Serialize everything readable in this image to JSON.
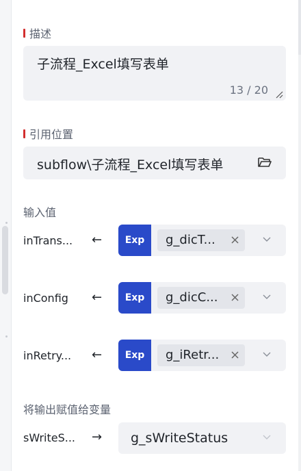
{
  "description": {
    "label": "描述",
    "value": "子流程_Excel填写表单",
    "counter": "13 / 20"
  },
  "reference": {
    "label": "引用位置",
    "value": "subflow\\子流程_Excel填写表单"
  },
  "inputs": {
    "label": "输入值",
    "items": [
      {
        "name": "inTrans...",
        "arrow": "←",
        "mode": "Exp",
        "value": "g_dicT..."
      },
      {
        "name": "inConfig",
        "arrow": "←",
        "mode": "Exp",
        "value": "g_dicC..."
      },
      {
        "name": "inRetry...",
        "arrow": "←",
        "mode": "Exp",
        "value": "g_iRetr..."
      }
    ]
  },
  "outputs": {
    "label": "将输出赋值给变量",
    "items": [
      {
        "name": "sWriteS...",
        "arrow": "→",
        "value": "g_sWriteStatus"
      }
    ]
  },
  "colors": {
    "accent": "#d32f2f",
    "exp_badge": "#2a4ac9",
    "field_bg": "#f1f2f5"
  }
}
